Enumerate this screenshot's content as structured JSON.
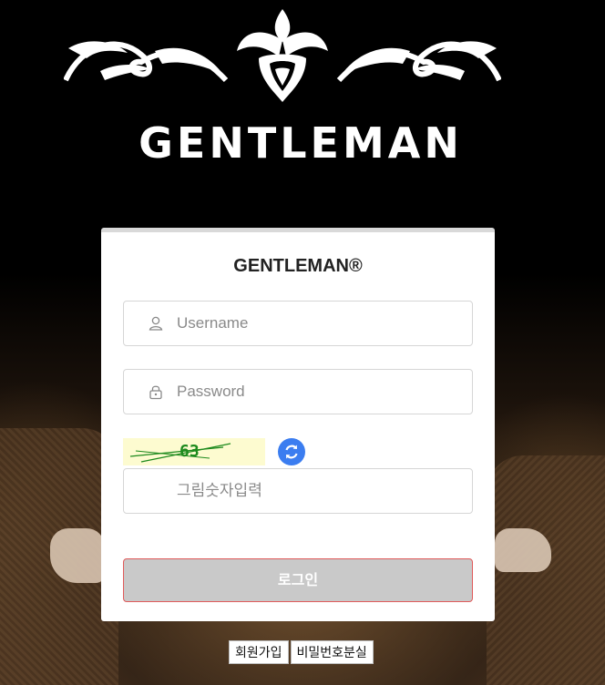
{
  "brand": {
    "logo_text": "GENTLEMAN"
  },
  "login_card": {
    "title": "GENTLEMAN®",
    "username": {
      "placeholder": "Username",
      "value": "",
      "icon": "user-icon"
    },
    "password": {
      "placeholder": "Password",
      "value": "",
      "icon": "lock-icon"
    },
    "captcha": {
      "code": "63",
      "refresh_icon": "refresh-icon"
    },
    "captcha_input": {
      "placeholder": "그림숫자입력",
      "value": ""
    },
    "login_button": "로그인"
  },
  "footer_links": {
    "signup": "회원가입",
    "find_password": "비밀번호분실"
  },
  "colors": {
    "accent_refresh": "#3b7df0",
    "login_border": "#e05a5a",
    "login_bg": "#c9c9c9"
  }
}
